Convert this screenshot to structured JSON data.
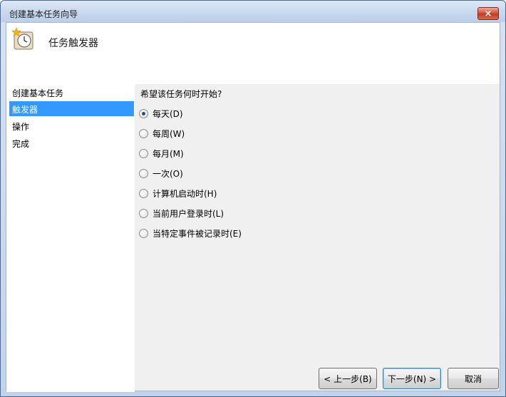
{
  "window": {
    "title": "创建基本任务向导",
    "close_label": "×"
  },
  "header": {
    "title": "任务触发器",
    "icon": "clock-icon"
  },
  "nav": {
    "items": [
      {
        "label": "创建基本任务",
        "selected": false
      },
      {
        "label": "触发器",
        "selected": true
      },
      {
        "label": "操作",
        "selected": false
      },
      {
        "label": "完成",
        "selected": false
      }
    ]
  },
  "content": {
    "question": "希望该任务何时开始?",
    "options": [
      {
        "label": "每天(D)",
        "checked": true
      },
      {
        "label": "每周(W)",
        "checked": false
      },
      {
        "label": "每月(M)",
        "checked": false
      },
      {
        "label": "一次(O)",
        "checked": false
      },
      {
        "label": "计算机启动时(H)",
        "checked": false
      },
      {
        "label": "当前用户登录时(L)",
        "checked": false
      },
      {
        "label": "当特定事件被记录时(E)",
        "checked": false
      }
    ]
  },
  "buttons": {
    "back": "< 上一步(B)",
    "next": "下一步(N) >",
    "cancel": "取消"
  },
  "colors": {
    "selection": "#3399ff",
    "close": "#c23b22"
  }
}
